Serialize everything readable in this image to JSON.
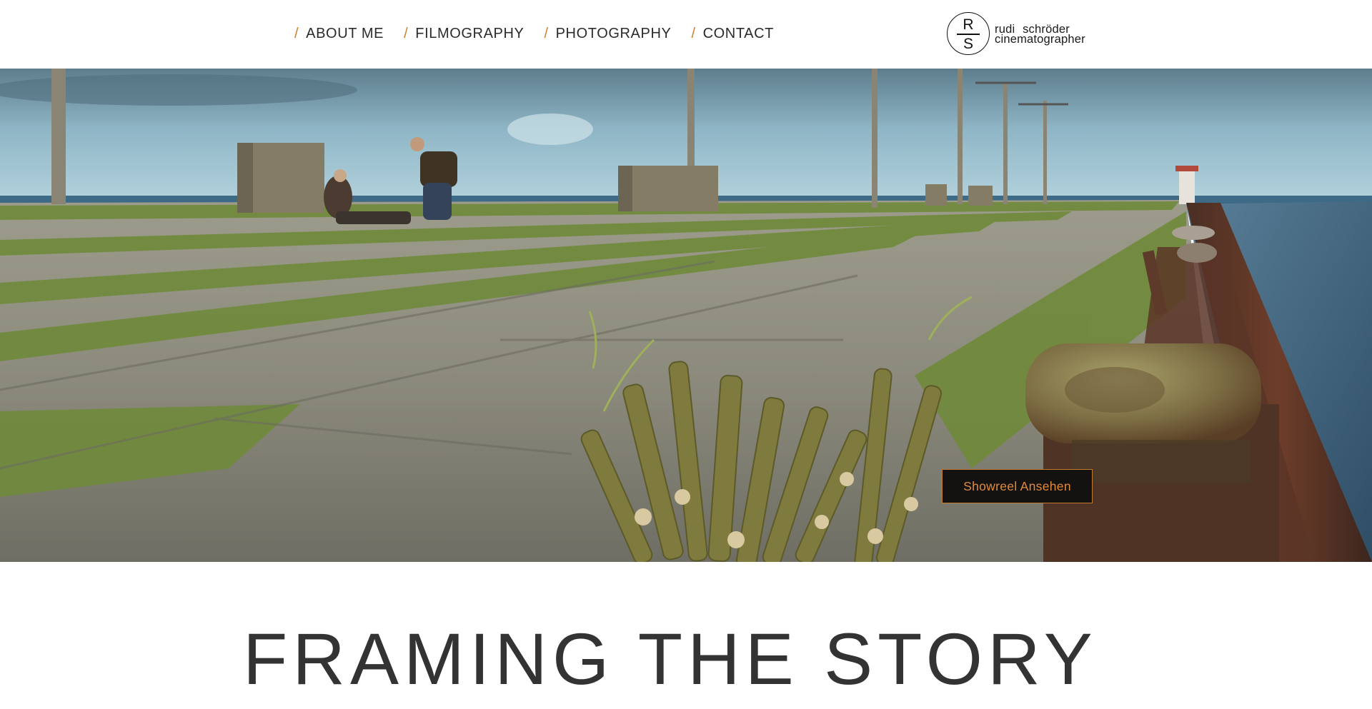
{
  "nav": {
    "separator": "/",
    "items": [
      {
        "label": "ABOUT ME"
      },
      {
        "label": "FILMOGRAPHY"
      },
      {
        "label": "PHOTOGRAPHY"
      },
      {
        "label": "CONTACT"
      }
    ]
  },
  "logo": {
    "monogram_top": "R",
    "monogram_bottom": "S",
    "line1": "rudi schröder",
    "line2": "cinematographer"
  },
  "hero": {
    "button_label": "Showreel Ansehen"
  },
  "headline": "FRAMING THE STORY",
  "colors": {
    "accent": "#d0802a",
    "button_bg": "#141210",
    "text": "#333333"
  }
}
